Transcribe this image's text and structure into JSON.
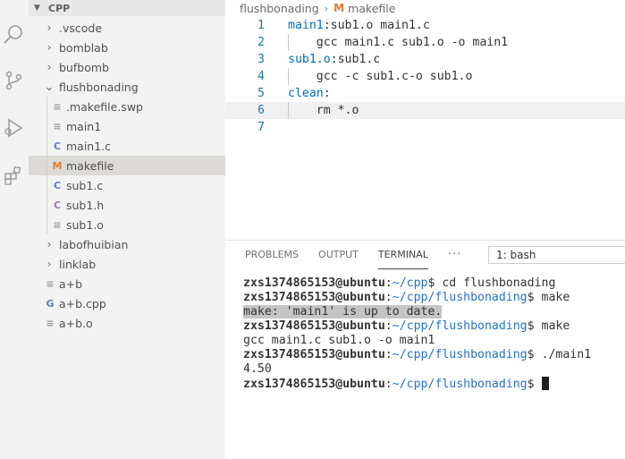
{
  "explorer": {
    "root_label": "CPP",
    "items": [
      {
        "label": ".vscode",
        "type": "folder",
        "expanded": false,
        "depth": 1
      },
      {
        "label": "bomblab",
        "type": "folder",
        "expanded": false,
        "depth": 1
      },
      {
        "label": "bufbomb",
        "type": "folder",
        "expanded": false,
        "depth": 1
      },
      {
        "label": "flushbonading",
        "type": "folder",
        "expanded": true,
        "depth": 1
      },
      {
        "label": ".makefile.swp",
        "type": "file",
        "icon": "lines-file-icon",
        "depth": 2
      },
      {
        "label": "main1",
        "type": "file",
        "icon": "lines-file-icon",
        "depth": 2
      },
      {
        "label": "main1.c",
        "type": "file",
        "icon": "c-file-icon",
        "depth": 2
      },
      {
        "label": "makefile",
        "type": "file",
        "icon": "makefile-icon",
        "depth": 2,
        "selected": true
      },
      {
        "label": "sub1.c",
        "type": "file",
        "icon": "c-file-icon",
        "depth": 2
      },
      {
        "label": "sub1.h",
        "type": "file",
        "icon": "h-file-icon",
        "depth": 2
      },
      {
        "label": "sub1.o",
        "type": "file",
        "icon": "lines-file-icon",
        "depth": 2
      },
      {
        "label": "labofhuibian",
        "type": "folder",
        "expanded": false,
        "depth": 1
      },
      {
        "label": "linklab",
        "type": "folder",
        "expanded": false,
        "depth": 1
      },
      {
        "label": "a+b",
        "type": "file",
        "icon": "lines-file-icon",
        "depth": 1
      },
      {
        "label": "a+b.cpp",
        "type": "file",
        "icon": "cpp-file-icon",
        "depth": 1
      },
      {
        "label": "a+b.o",
        "type": "file",
        "icon": "lines-file-icon",
        "depth": 1
      }
    ]
  },
  "editor": {
    "breadcrumb": {
      "folder": "flushbonading",
      "file": "makefile",
      "file_icon": "M"
    },
    "lines": [
      {
        "num": "1",
        "target": "main1",
        "rest": ":sub1.o main1.c"
      },
      {
        "num": "2",
        "target": "",
        "rest": "    gcc main1.c sub1.o -o main1"
      },
      {
        "num": "3",
        "target": "sub1.o",
        "rest": ":sub1.c"
      },
      {
        "num": "4",
        "target": "",
        "rest": "    gcc -c sub1.c-o sub1.o"
      },
      {
        "num": "5",
        "target": "clean",
        "rest": ":"
      },
      {
        "num": "6",
        "target": "",
        "rest": "    rm *.o"
      },
      {
        "num": "7",
        "target": "",
        "rest": ""
      }
    ]
  },
  "panel": {
    "tabs": [
      "PROBLEMS",
      "OUTPUT",
      "TERMINAL"
    ],
    "active_tab": "TERMINAL",
    "more": "···",
    "terminal_select": "1: bash",
    "terminal": {
      "user": "zxs1374865153@ubuntu",
      "lines": [
        {
          "kind": "prompt",
          "path": "~/cpp",
          "cmd": " cd flushbonading"
        },
        {
          "kind": "prompt",
          "path": "~/cpp/flushbonading",
          "cmd": " make"
        },
        {
          "kind": "output-highlight",
          "text": "make: 'main1' is up to date."
        },
        {
          "kind": "prompt",
          "path": "~/cpp/flushbonading",
          "cmd": " make"
        },
        {
          "kind": "output",
          "text": "gcc main1.c sub1.o -o main1"
        },
        {
          "kind": "prompt",
          "path": "~/cpp/flushbonading",
          "cmd": " ./main1"
        },
        {
          "kind": "output",
          "text": "4.50"
        },
        {
          "kind": "prompt-cursor",
          "path": "~/cpp/flushbonading",
          "cmd": " "
        }
      ]
    }
  },
  "colors": {
    "keyword": "#0070c1",
    "line_number": "#237893",
    "prompt_path": "#2672c8",
    "makefile_icon": "#e37933",
    "c_icon": "#5f7fc4",
    "h_icon": "#a074c4"
  }
}
